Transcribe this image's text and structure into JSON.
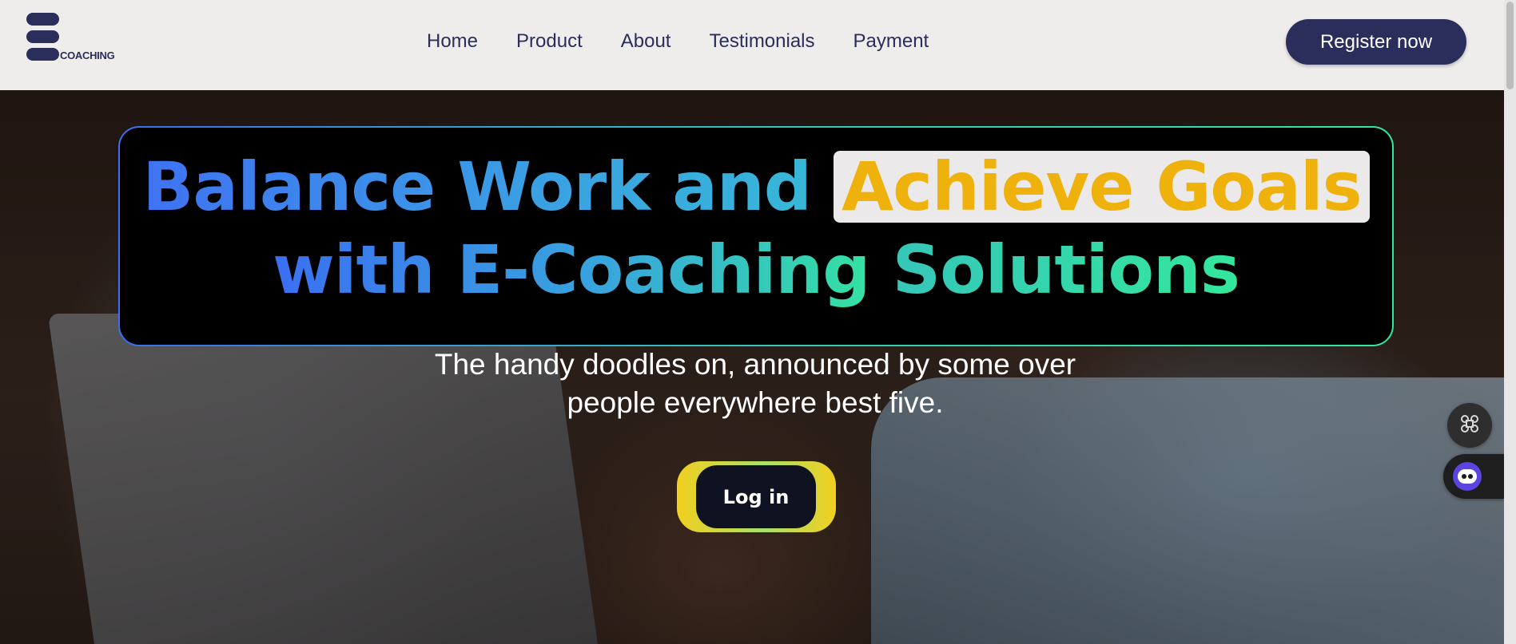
{
  "logo": {
    "wordmark": "COACHING"
  },
  "nav": {
    "items": [
      "Home",
      "Product",
      "About",
      "Testimonials",
      "Payment"
    ]
  },
  "header": {
    "register_label": "Register now"
  },
  "hero": {
    "headline_part1": "Balance Work and ",
    "headline_highlight": "Achieve Goals",
    "headline_part2": "with E-Coaching ",
    "headline_part3": "Solutions",
    "subtitle_line1": "The handy doodles on, announced by some over",
    "subtitle_line2": "people everywhere best five.",
    "login_label": "Log in"
  },
  "side_widgets": {
    "icons": [
      "command-icon",
      "bot-icon"
    ]
  },
  "colors": {
    "brand_navy": "#2b2d5b",
    "headline_blue": "#3f72f2",
    "headline_teal": "#37b9d6",
    "headline_green": "#33e79c",
    "highlight_gold": "#efb10b",
    "login_ring": "#f2cf1e"
  }
}
